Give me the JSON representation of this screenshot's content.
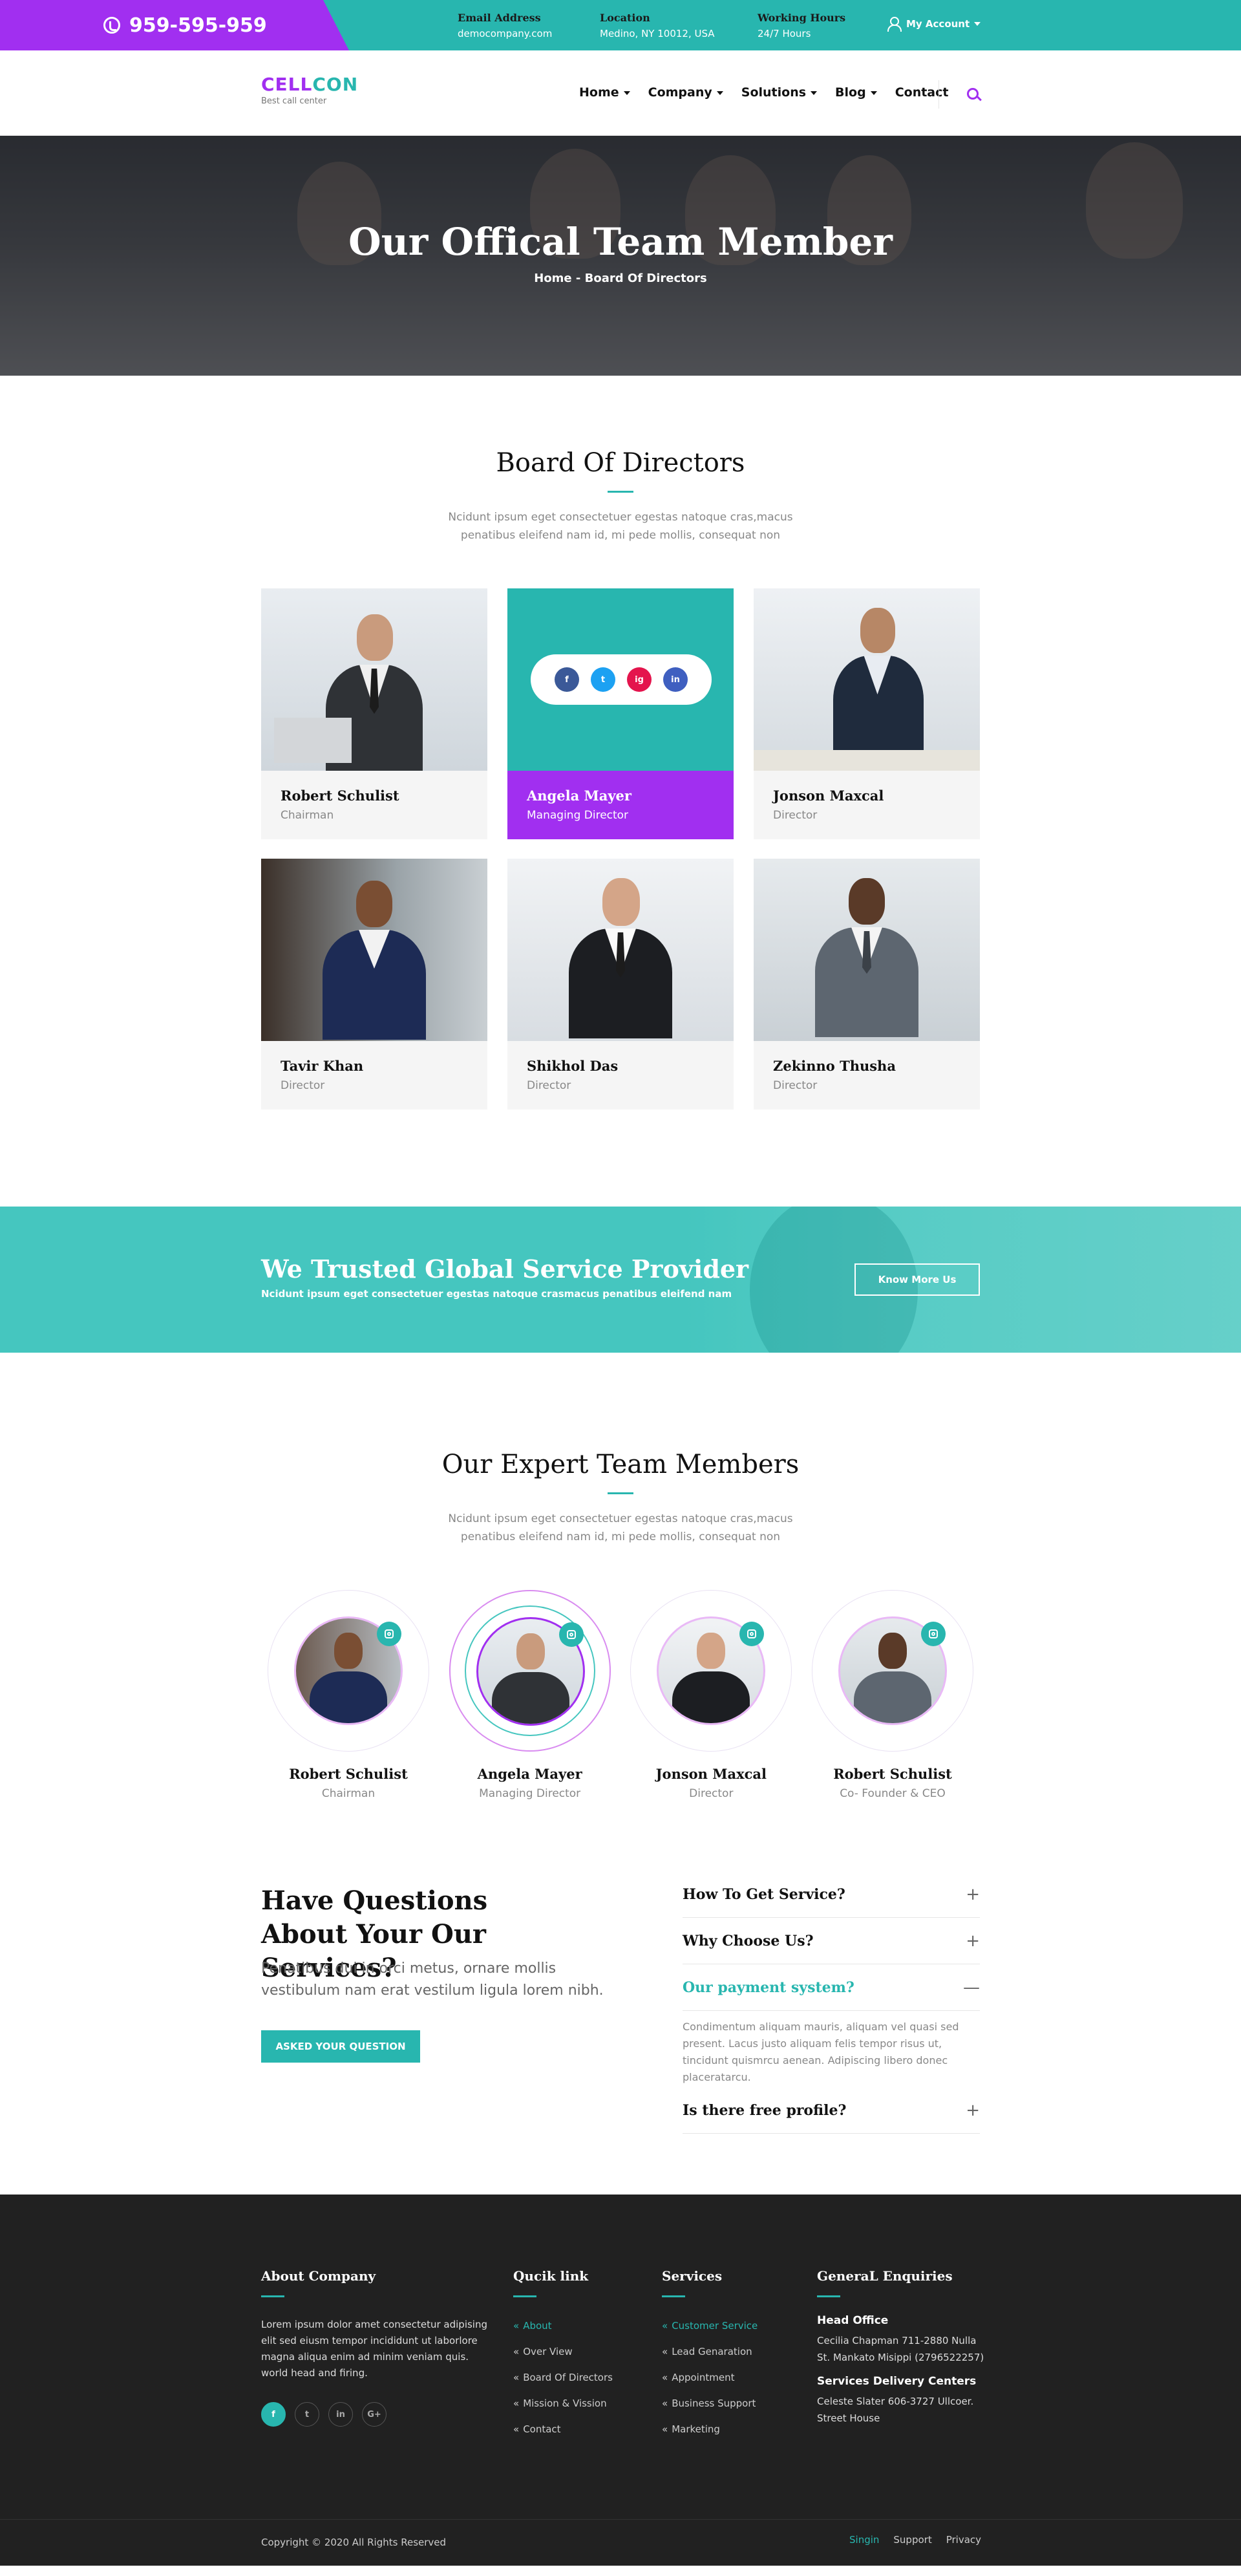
{
  "topbar": {
    "phone": "959-595-959",
    "email_label": "Email Address",
    "email_value": "democompany.com",
    "location_label": "Location",
    "location_value": "Medino, NY 10012, USA",
    "hours_label": "Working Hours",
    "hours_value": "24/7 Hours",
    "account": "My Account"
  },
  "brand": {
    "logo_part1": "CELL",
    "logo_part2": "CON",
    "tagline": "Best call center"
  },
  "nav": {
    "items": [
      "Home",
      "Company",
      "Solutions",
      "Blog",
      "Contact"
    ]
  },
  "hero": {
    "title": "Our Offical Team Member",
    "breadcrumb": "Home - Board Of Directors"
  },
  "board": {
    "title": "Board Of Directors",
    "subtitle": "Ncidunt ipsum eget consectetuer egestas natoque cras,macus penatibus eleifend nam id, mi pede mollis, consequat non",
    "members": [
      {
        "name": "Robert Schulist",
        "role": "Chairman"
      },
      {
        "name": "Angela Mayer",
        "role": "Managing Director"
      },
      {
        "name": "Jonson Maxcal",
        "role": "Director"
      },
      {
        "name": "Tavir Khan",
        "role": "Director"
      },
      {
        "name": "Shikhol Das",
        "role": "Director"
      },
      {
        "name": "Zekinno Thusha",
        "role": "Director"
      }
    ],
    "social": [
      "f",
      "t",
      "ig",
      "in"
    ]
  },
  "banner": {
    "title": "We Trusted Global Service Provider",
    "text": "Ncidunt ipsum eget consectetuer egestas natoque crasmacus penatibus eleifend nam",
    "button": "Know More Us"
  },
  "expert": {
    "title": "Our Expert Team Members",
    "subtitle": "Ncidunt ipsum eget consectetuer egestas natoque cras,macus penatibus eleifend nam id, mi pede mollis, consequat non",
    "members": [
      {
        "name": "Robert Schulist",
        "role": "Chairman"
      },
      {
        "name": "Angela Mayer",
        "role": "Managing Director"
      },
      {
        "name": "Jonson Maxcal",
        "role": "Director"
      },
      {
        "name": "Robert Schulist",
        "role": "Co- Founder & CEO"
      }
    ]
  },
  "faq": {
    "title": "Have Questions About Your Our Services?",
    "lead": "Penatibus dui in orci metus, ornare mollis vestibulum nam erat vestilum ligula lorem nibh.",
    "button": "ASKED YOUR QUESTION",
    "items": [
      {
        "q": "How To Get Service?",
        "sign": "+"
      },
      {
        "q": "Why Choose Us?",
        "sign": "+"
      },
      {
        "q": "Our payment system?",
        "sign": "—",
        "a": "Condimentum aliquam mauris, aliquam vel quasi sed present. Lacus justo aliquam felis tempor risus ut, tincidunt quismrcu aenean. Adipiscing libero donec placeratarcu."
      },
      {
        "q": "Is there free profile?",
        "sign": "+"
      }
    ]
  },
  "footer": {
    "about_title": "About Company",
    "about_text": "Lorem ipsum dolor amet consectetur adipising elit sed eiusm tempor incididunt ut laborlore magna aliqua enim ad minim veniam quis. world head and firing.",
    "social": [
      "f",
      "t",
      "in",
      "G+"
    ],
    "quick_title": "Qucik link",
    "quick_links": [
      "About",
      "Over View",
      "Board Of Directors",
      "Mission & Vission",
      "Contact"
    ],
    "services_title": "Services",
    "services_links": [
      "Customer Service",
      "Lead Genaration",
      "Appointment",
      "Business Support",
      "Marketing"
    ],
    "enq_title": "GeneraL Enquiries",
    "head_office_title": "Head Office",
    "head_office_text": "Cecilia Chapman 711-2880 Nulla St. Mankato Misippi (2796522257)",
    "delivery_title": "Services Delivery Centers",
    "delivery_text": "Celeste Slater 606-3727 Ullcoer. Street House",
    "copyright": "Copyright © 2020 All Rights Reserved",
    "bottom_links": [
      "Singin",
      "Support",
      "Privacy"
    ]
  },
  "colors": {
    "teal": "#28b6af",
    "purple": "#a12ff0",
    "dark": "#212121"
  }
}
